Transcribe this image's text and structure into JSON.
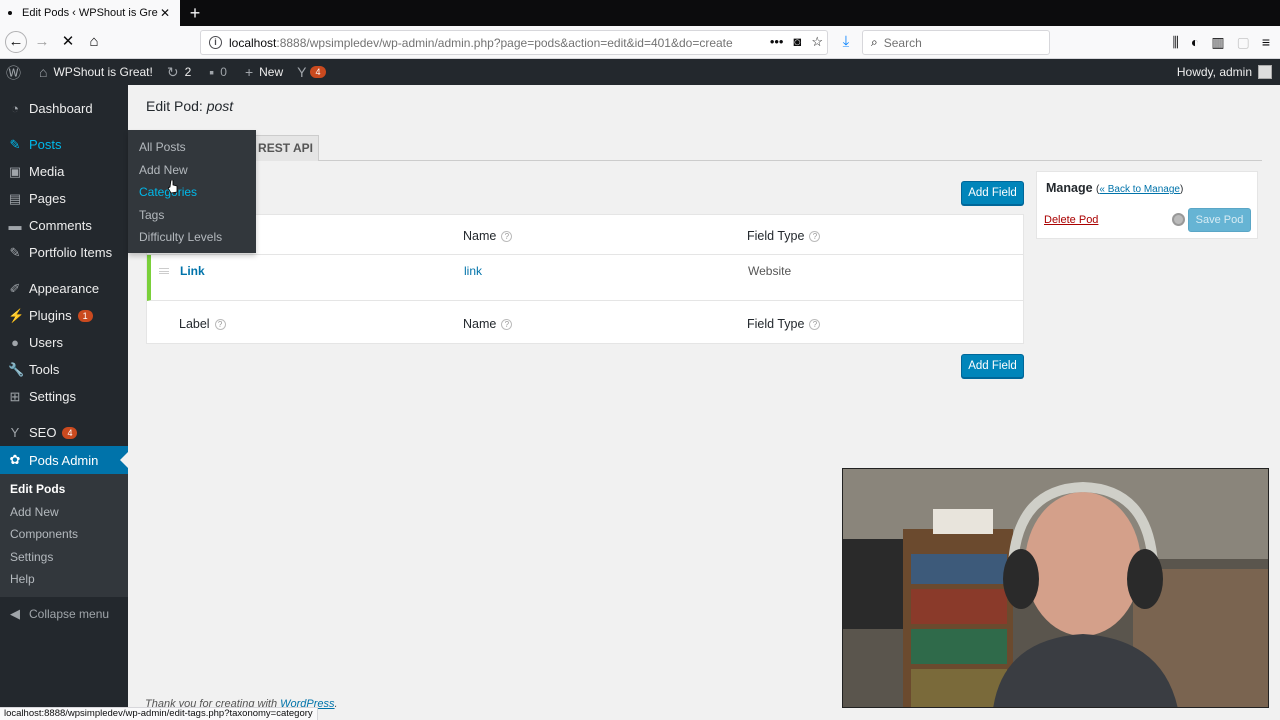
{
  "browser": {
    "tab_title": "Edit Pods ‹ WPShout is Great! —",
    "url_host": "localhost",
    "url_path": ":8888/wpsimpledev/wp-admin/admin.php?page=pods&action=edit&id=401&do=create",
    "search_placeholder": "Search",
    "status_url": "localhost:8888/wpsimpledev/wp-admin/edit-tags.php?taxonomy=category"
  },
  "adminbar": {
    "site_name": "WPShout is Great!",
    "updates_count": "2",
    "comments_count": "0",
    "new_label": "New",
    "seo_badge": "4",
    "howdy": "Howdy, admin"
  },
  "menu": {
    "dashboard": "Dashboard",
    "posts": "Posts",
    "media": "Media",
    "pages": "Pages",
    "comments": "Comments",
    "portfolio": "Portfolio Items",
    "appearance": "Appearance",
    "plugins": "Plugins",
    "plugins_badge": "1",
    "users": "Users",
    "tools": "Tools",
    "settings": "Settings",
    "seo": "SEO",
    "seo_badge": "4",
    "pods_admin": "Pods Admin",
    "sub_edit_pods": "Edit Pods",
    "sub_add_new": "Add New",
    "sub_components": "Components",
    "sub_settings": "Settings",
    "sub_help": "Help",
    "collapse": "Collapse menu"
  },
  "flyout": {
    "all_posts": "All Posts",
    "add_new": "Add New",
    "categories": "Categories",
    "tags": "Tags",
    "difficulty": "Difficulty Levels"
  },
  "main": {
    "title_prefix": "Edit Pod:",
    "title_pod": "post",
    "tab_rest": "REST API",
    "add_field": "Add Field",
    "col_label": "Label",
    "col_name": "Name",
    "col_type": "Field Type",
    "field_label": "Link",
    "field_name": "link",
    "field_type": "Website"
  },
  "manage": {
    "title": "Manage",
    "back_open": "(",
    "back_link": "« Back to Manage",
    "back_close": ")",
    "delete": "Delete Pod",
    "save": "Save Pod"
  },
  "footer": {
    "thanks": "Thank you for creating with",
    "wp_link": "WordPress",
    "period": "."
  },
  "colors": {
    "admin_dark": "#23282d",
    "accent_blue": "#0073aa",
    "button_blue": "#0085ba",
    "field_border_green": "#7ad03a",
    "badge_red": "#ca4a1f"
  }
}
